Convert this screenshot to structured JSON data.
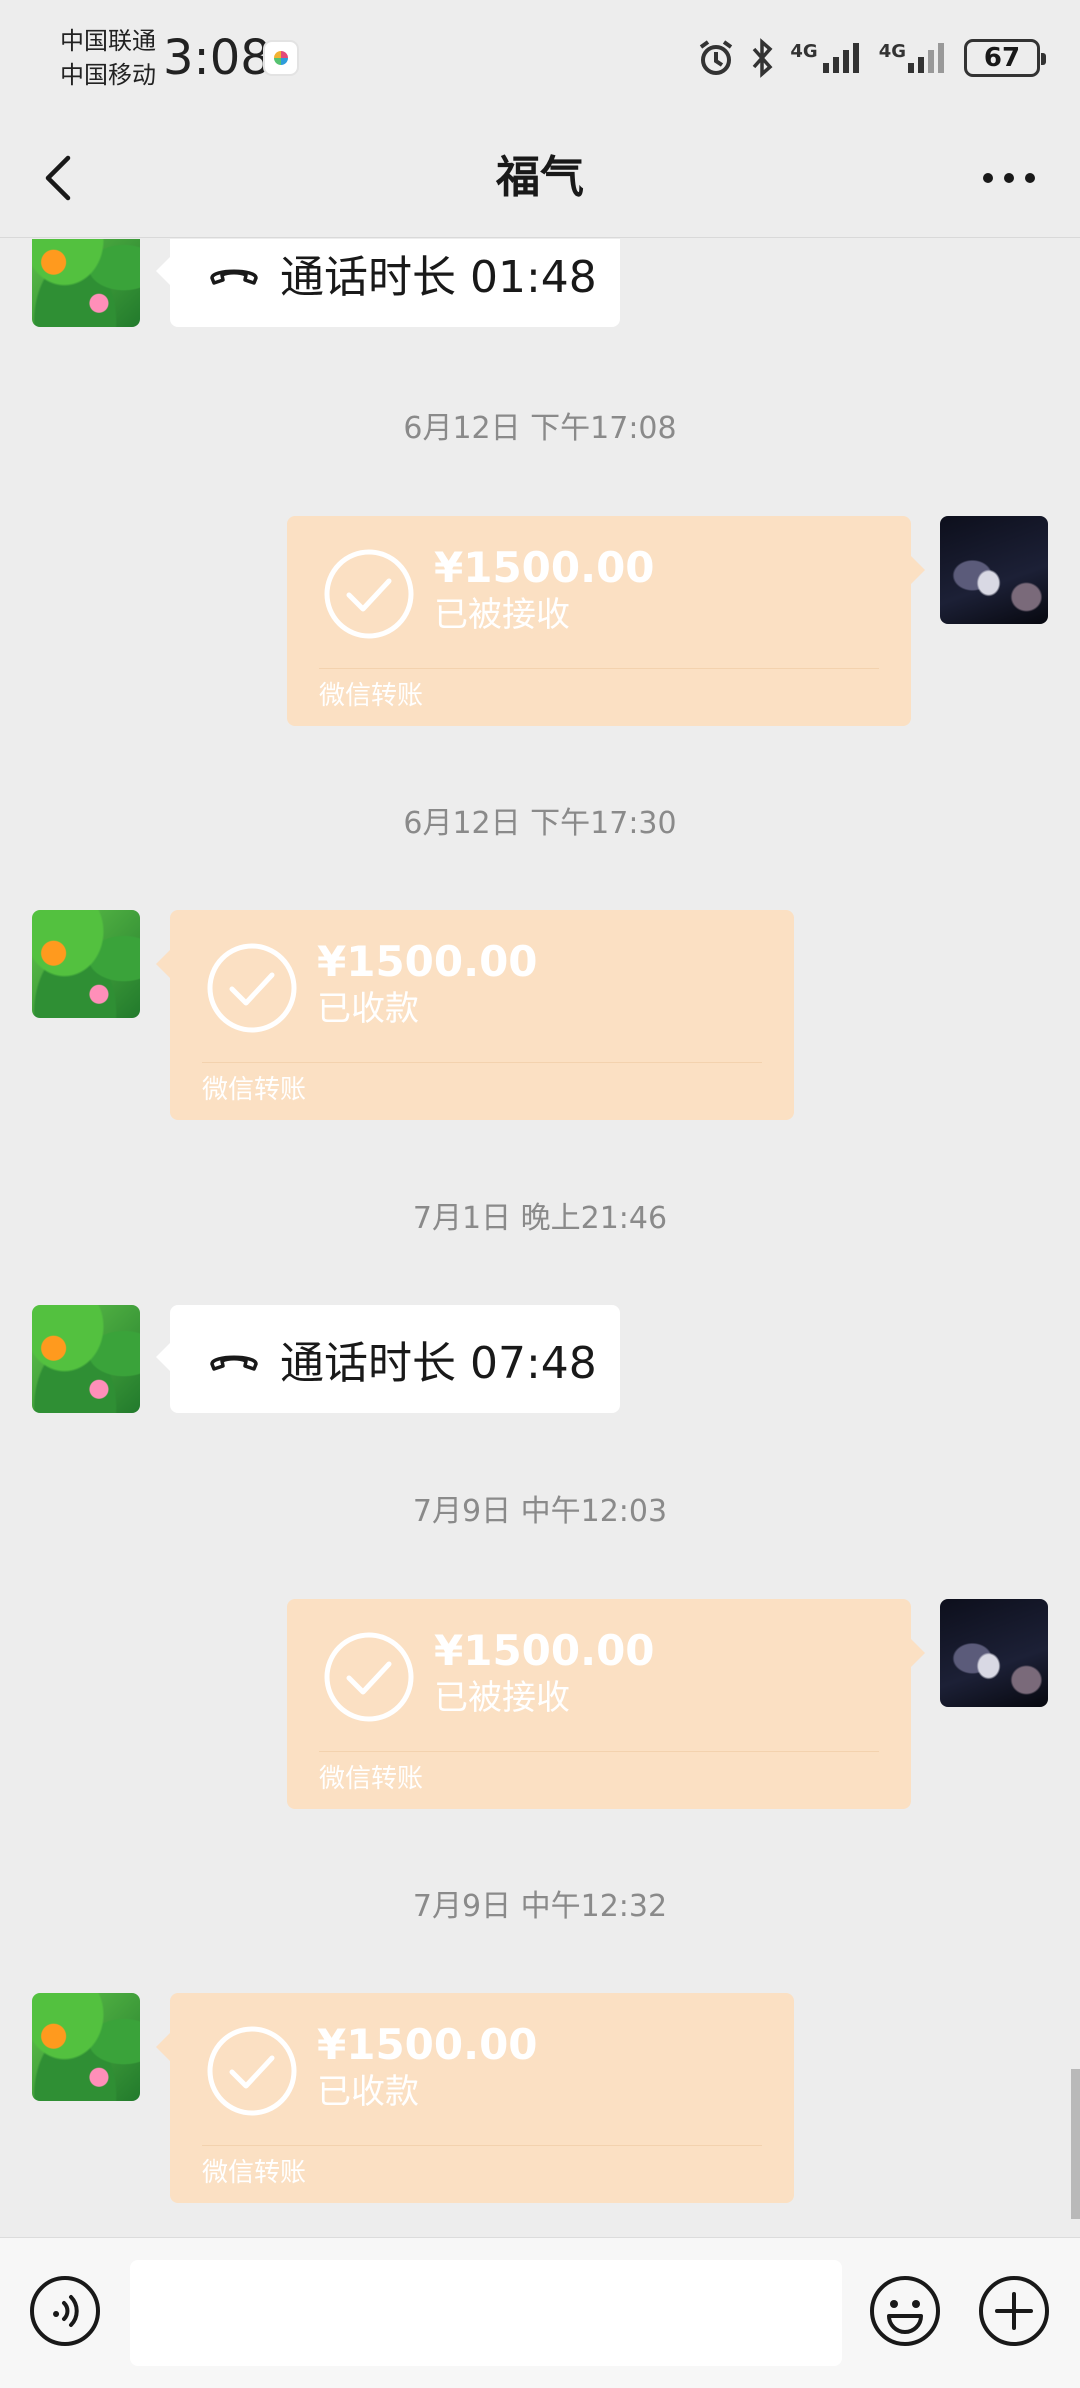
{
  "status_bar": {
    "carrier_1": "中国联通",
    "carrier_2": "中国移动",
    "time": "3:08",
    "network_1": "4G",
    "network_2": "4G",
    "battery": "67",
    "icons": [
      "alarm-icon",
      "bluetooth-icon",
      "signal-icon",
      "battery-icon"
    ]
  },
  "header": {
    "title": "福气",
    "back_icon": "chevron-left-icon",
    "more_icon": "more-dots-icon"
  },
  "messages": [
    {
      "type": "call",
      "side": "left",
      "label": "通话时长 01:48"
    },
    {
      "type": "timestamp",
      "text": "6月12日 下午17:08"
    },
    {
      "type": "transfer",
      "side": "right",
      "amount": "¥1500.00",
      "status": "已被接收",
      "footer": "微信转账"
    },
    {
      "type": "timestamp",
      "text": "6月12日 下午17:30"
    },
    {
      "type": "transfer",
      "side": "left",
      "amount": "¥1500.00",
      "status": "已收款",
      "footer": "微信转账"
    },
    {
      "type": "timestamp",
      "text": "7月1日 晚上21:46"
    },
    {
      "type": "call",
      "side": "left",
      "label": "通话时长 07:48"
    },
    {
      "type": "timestamp",
      "text": "7月9日 中午12:03"
    },
    {
      "type": "transfer",
      "side": "right",
      "amount": "¥1500.00",
      "status": "已被接收",
      "footer": "微信转账"
    },
    {
      "type": "timestamp",
      "text": "7月9日 中午12:32"
    },
    {
      "type": "transfer",
      "side": "left",
      "amount": "¥1500.00",
      "status": "已收款",
      "footer": "微信转账"
    }
  ],
  "input_bar": {
    "text_value": "",
    "icons": [
      "voice-icon",
      "emoji-icon",
      "plus-icon"
    ]
  },
  "colors": {
    "background": "#ededed",
    "transfer_bubble": "#fbe0c3",
    "call_bubble": "#ffffff",
    "timestamp_text": "#8a8a8a"
  }
}
